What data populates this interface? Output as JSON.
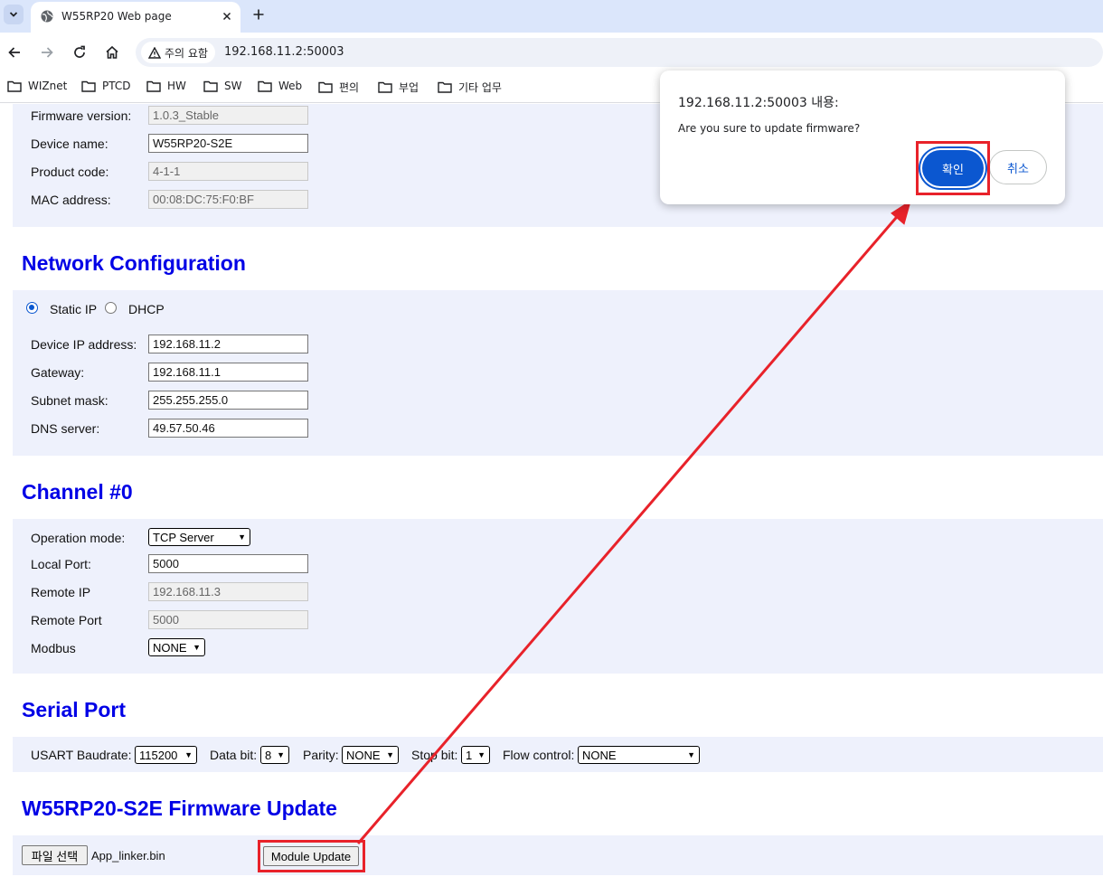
{
  "browser": {
    "tab_title": "W55RP20 Web page",
    "security_label": "주의 요함",
    "url": "192.168.11.2:50003",
    "bookmarks": [
      "WIZnet",
      "PTCD",
      "HW",
      "SW",
      "Web",
      "편의",
      "부업",
      "기타 업무"
    ]
  },
  "device_info": {
    "firmware_version_label": "Firmware version:",
    "firmware_version": "1.0.3_Stable",
    "device_name_label": "Device name:",
    "device_name": "W55RP20-S2E",
    "product_code_label": "Product code:",
    "product_code": "4-1-1",
    "mac_label": "MAC address:",
    "mac": "00:08:DC:75:F0:BF"
  },
  "network": {
    "heading": "Network Configuration",
    "static_ip_label": "Static IP",
    "dhcp_label": "DHCP",
    "mode": "Static IP",
    "ip_label": "Device IP address:",
    "ip": "192.168.11.2",
    "gateway_label": "Gateway:",
    "gateway": "192.168.11.1",
    "subnet_label": "Subnet mask:",
    "subnet": "255.255.255.0",
    "dns_label": "DNS server:",
    "dns": "49.57.50.46"
  },
  "channel": {
    "heading": "Channel #0",
    "mode_label": "Operation mode:",
    "mode": "TCP Server",
    "local_port_label": "Local Port:",
    "local_port": "5000",
    "remote_ip_label": "Remote IP",
    "remote_ip": "192.168.11.3",
    "remote_port_label": "Remote Port",
    "remote_port": "5000",
    "modbus_label": "Modbus",
    "modbus": "NONE"
  },
  "serial": {
    "heading": "Serial Port",
    "baud_label": "USART Baudrate:",
    "baud": "115200",
    "databit_label": "Data bit:",
    "databit": "8",
    "parity_label": "Parity:",
    "parity": "NONE",
    "stopbit_label": "Stop bit:",
    "stopbit": "1",
    "flow_label": "Flow control:",
    "flow": "NONE"
  },
  "firmware": {
    "heading": "W55RP20-S2E Firmware Update",
    "choose_file_label": "파일 선택",
    "file_name": "App_linker.bin",
    "update_button": "Module Update"
  },
  "dialog": {
    "title": "192.168.11.2:50003 내용:",
    "message": "Are you sure to update firmware?",
    "ok": "확인",
    "cancel": "취소"
  },
  "colors": {
    "heading": "#0000e6",
    "panel": "#eef1fc",
    "annotation": "#e8222a",
    "primary_button": "#0b57d0"
  }
}
